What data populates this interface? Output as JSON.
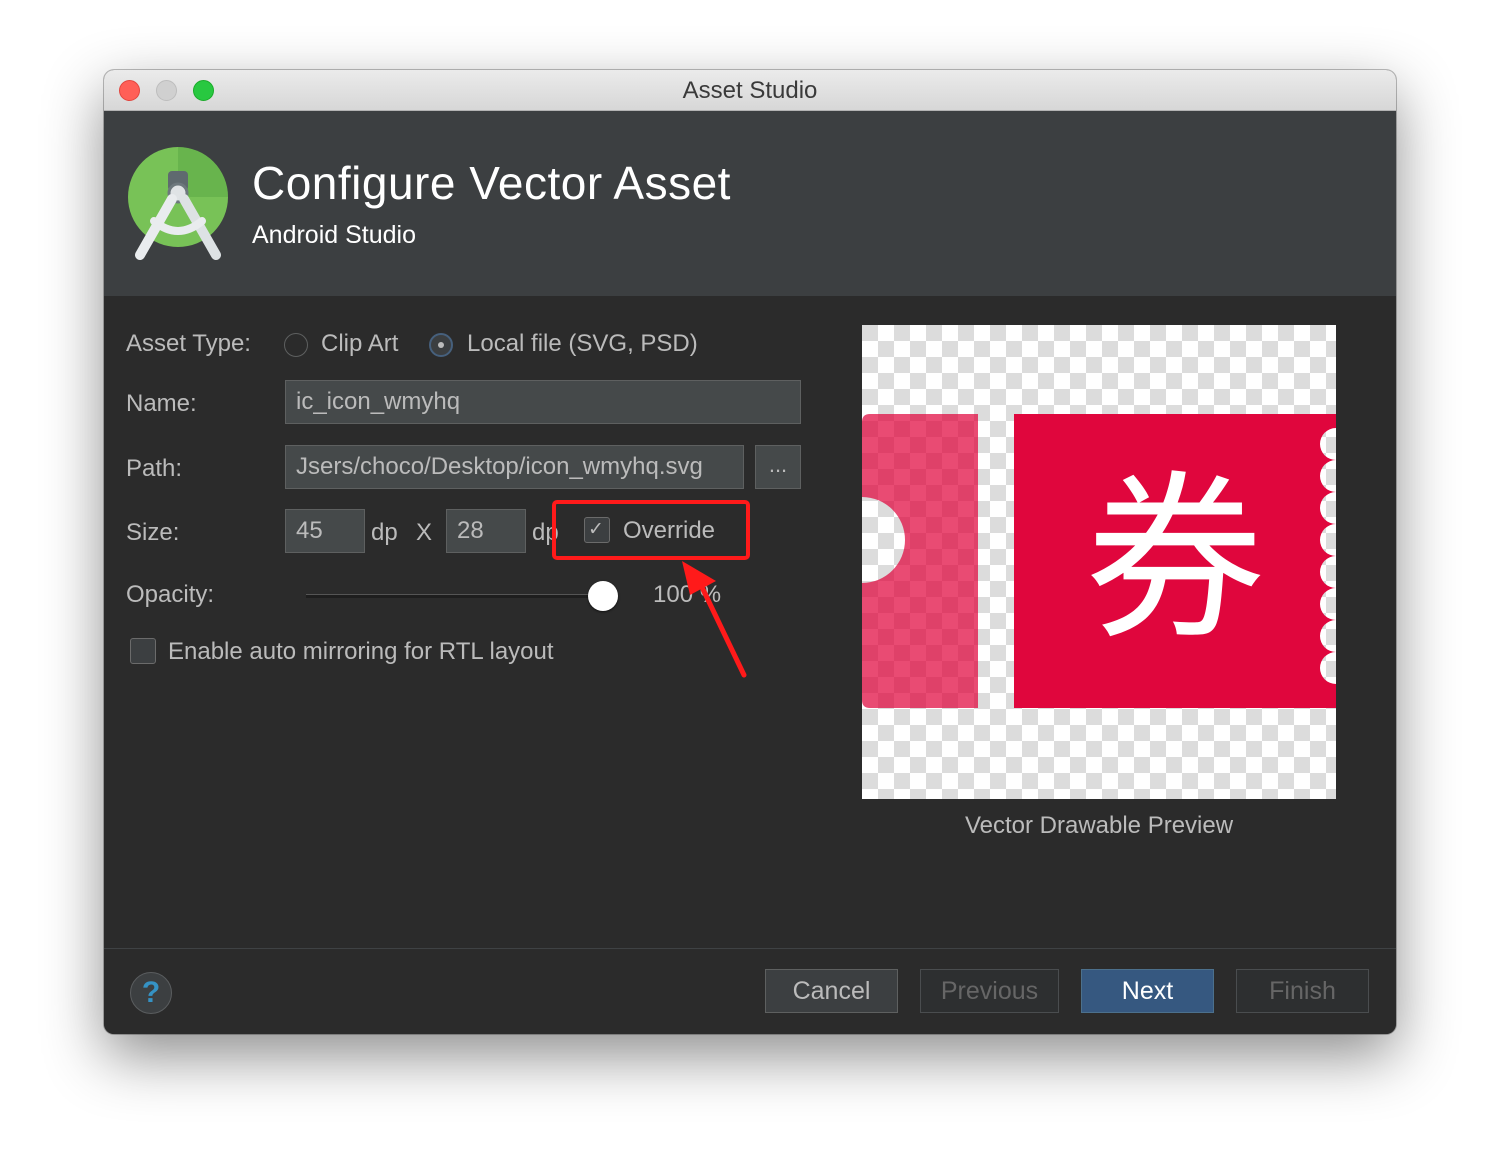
{
  "window": {
    "title": "Asset Studio"
  },
  "header": {
    "title": "Configure Vector Asset",
    "subtitle": "Android Studio"
  },
  "form": {
    "asset_type_label": "Asset Type:",
    "asset_type_options": [
      "Clip Art",
      "Local file (SVG, PSD)"
    ],
    "asset_type_selected": "Local file (SVG, PSD)",
    "name_label": "Name:",
    "name_value": "ic_icon_wmyhq",
    "path_label": "Path:",
    "path_value": "Jsers/choco/Desktop/icon_wmyhq.svg",
    "browse_label": "...",
    "size_label": "Size:",
    "width_value": "45",
    "width_unit": "dp",
    "size_separator": "X",
    "height_value": "28",
    "height_unit": "dp",
    "override_label": "Override",
    "override_checked": true,
    "opacity_label": "Opacity:",
    "opacity_value": "100 %",
    "opacity_level": 1.0,
    "rtl_label": "Enable auto mirroring for RTL layout",
    "rtl_checked": false
  },
  "preview": {
    "caption": "Vector Drawable Preview",
    "glyph": "券",
    "ticket_color": "#e0063d"
  },
  "footer": {
    "help_label": "?",
    "buttons": {
      "cancel": "Cancel",
      "previous": "Previous",
      "next": "Next",
      "finish": "Finish"
    }
  },
  "annotation": {
    "highlight_color": "#ff1a1a"
  },
  "colors": {
    "background": "#2b2b2b",
    "header": "#3c3f41",
    "primary_button": "#365880"
  }
}
